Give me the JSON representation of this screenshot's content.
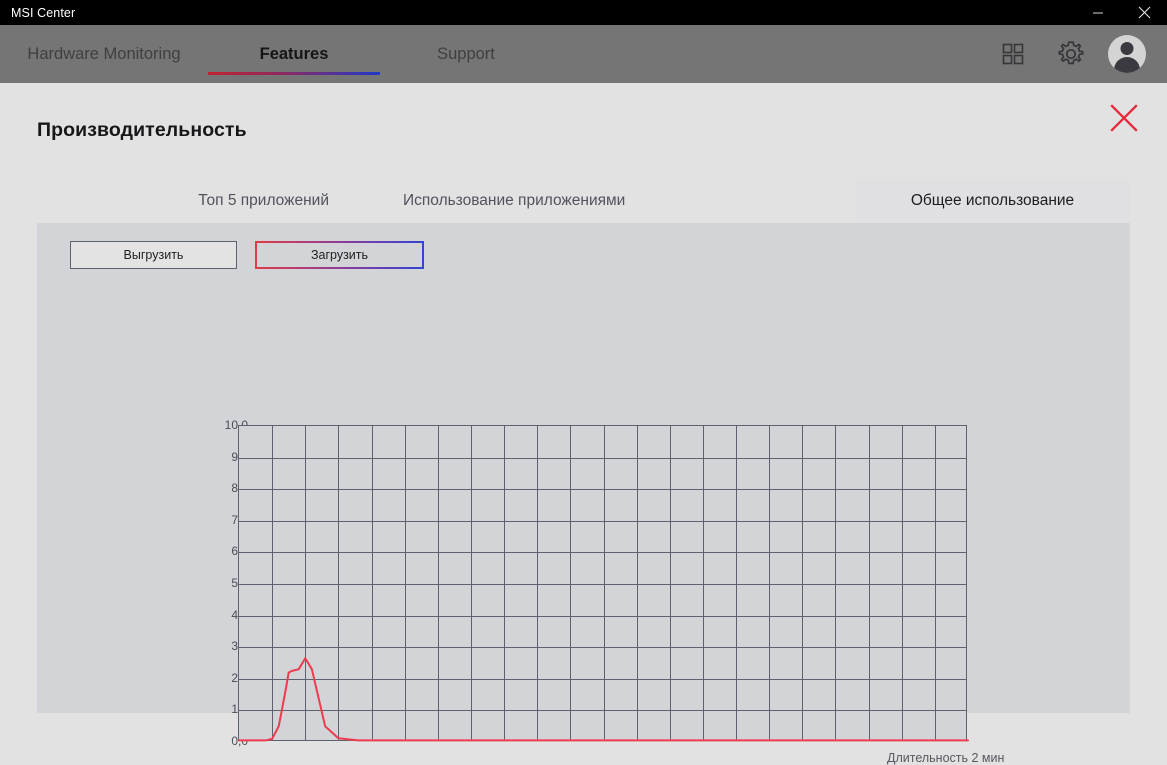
{
  "window": {
    "title": "MSI Center",
    "controls": [
      {
        "name": "minimize-button",
        "glyph": "minimize-icon"
      },
      {
        "name": "close-button",
        "glyph": "close-icon"
      }
    ]
  },
  "nav": {
    "tabs": [
      {
        "label": "Hardware Monitoring",
        "active": false
      },
      {
        "label": "Features",
        "active": true
      },
      {
        "label": "Support",
        "active": false
      }
    ],
    "icons": [
      {
        "name": "apps-grid-icon"
      },
      {
        "name": "gear-icon"
      },
      {
        "name": "avatar"
      }
    ],
    "accent_start": "#c3222f",
    "accent_end": "#2138c8"
  },
  "page": {
    "title": "Производительность",
    "close_icon": "close-icon",
    "close_color": "#e8283c"
  },
  "tabs": [
    {
      "label": "Топ 5 приложений",
      "active": false
    },
    {
      "label": "Использование приложениями",
      "active": false
    },
    {
      "label": "Общее использование",
      "active": true
    }
  ],
  "toolbar": {
    "export_label": "Выгрузить",
    "import_label": "Загрузить"
  },
  "chart_footer": {
    "duration_label": "Длительность 2 мин"
  },
  "chart_data": {
    "type": "line",
    "title": "",
    "xlabel": "Длительность 2 мин",
    "ylabel": "",
    "ylim": [
      0,
      10
    ],
    "yticks": [
      10,
      9,
      8,
      7,
      6,
      5,
      4,
      3,
      2,
      1,
      0
    ],
    "ytick_labels": [
      "10,0",
      "9,0",
      "8,0",
      "7,0",
      "6,0",
      "5,0",
      "4,0",
      "3,0",
      "2,0",
      "1,0",
      "0,0"
    ],
    "grid": true,
    "grid_columns": 22,
    "grid_rows": 10,
    "legend": "none",
    "line_color": "#ef3b4e",
    "series": [
      {
        "name": "Общее использование",
        "x": [
          0.0,
          0.4,
          0.8,
          1.0,
          1.2,
          1.4,
          1.5,
          1.6,
          1.8,
          2.0,
          2.2,
          2.4,
          2.6,
          3.0,
          3.6,
          4.4,
          6.0,
          9.0,
          12.0,
          16.0,
          20.0,
          22.0
        ],
        "values": [
          0.05,
          0.05,
          0.05,
          0.1,
          0.5,
          1.6,
          2.2,
          2.25,
          2.3,
          2.65,
          2.3,
          1.4,
          0.5,
          0.12,
          0.05,
          0.05,
          0.05,
          0.05,
          0.05,
          0.05,
          0.05,
          0.05
        ]
      }
    ]
  }
}
